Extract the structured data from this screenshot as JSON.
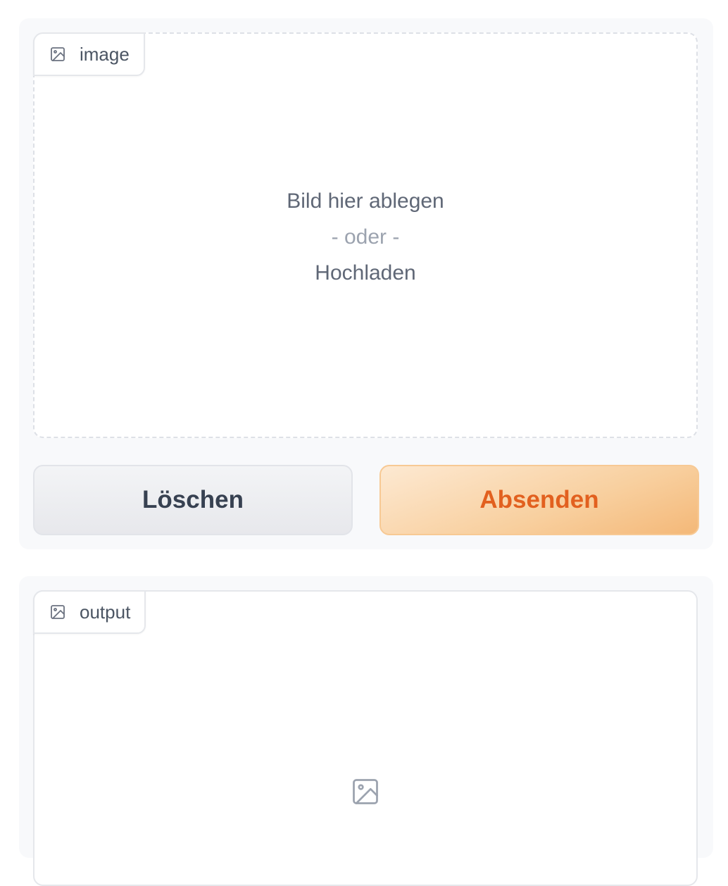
{
  "input": {
    "label": "image",
    "label_icon": "image-icon",
    "drop_line1": "Bild hier ablegen",
    "drop_line2": "- oder -",
    "drop_line3": "Hochladen"
  },
  "buttons": {
    "clear_label": "Löschen",
    "submit_label": "Absenden"
  },
  "output": {
    "label": "output",
    "label_icon": "image-icon",
    "placeholder_icon": "image-placeholder-icon"
  },
  "colors": {
    "accent_text": "#e2601f",
    "accent_bg": "#f8cf9e",
    "panel_bg": "#f8f9fb"
  }
}
